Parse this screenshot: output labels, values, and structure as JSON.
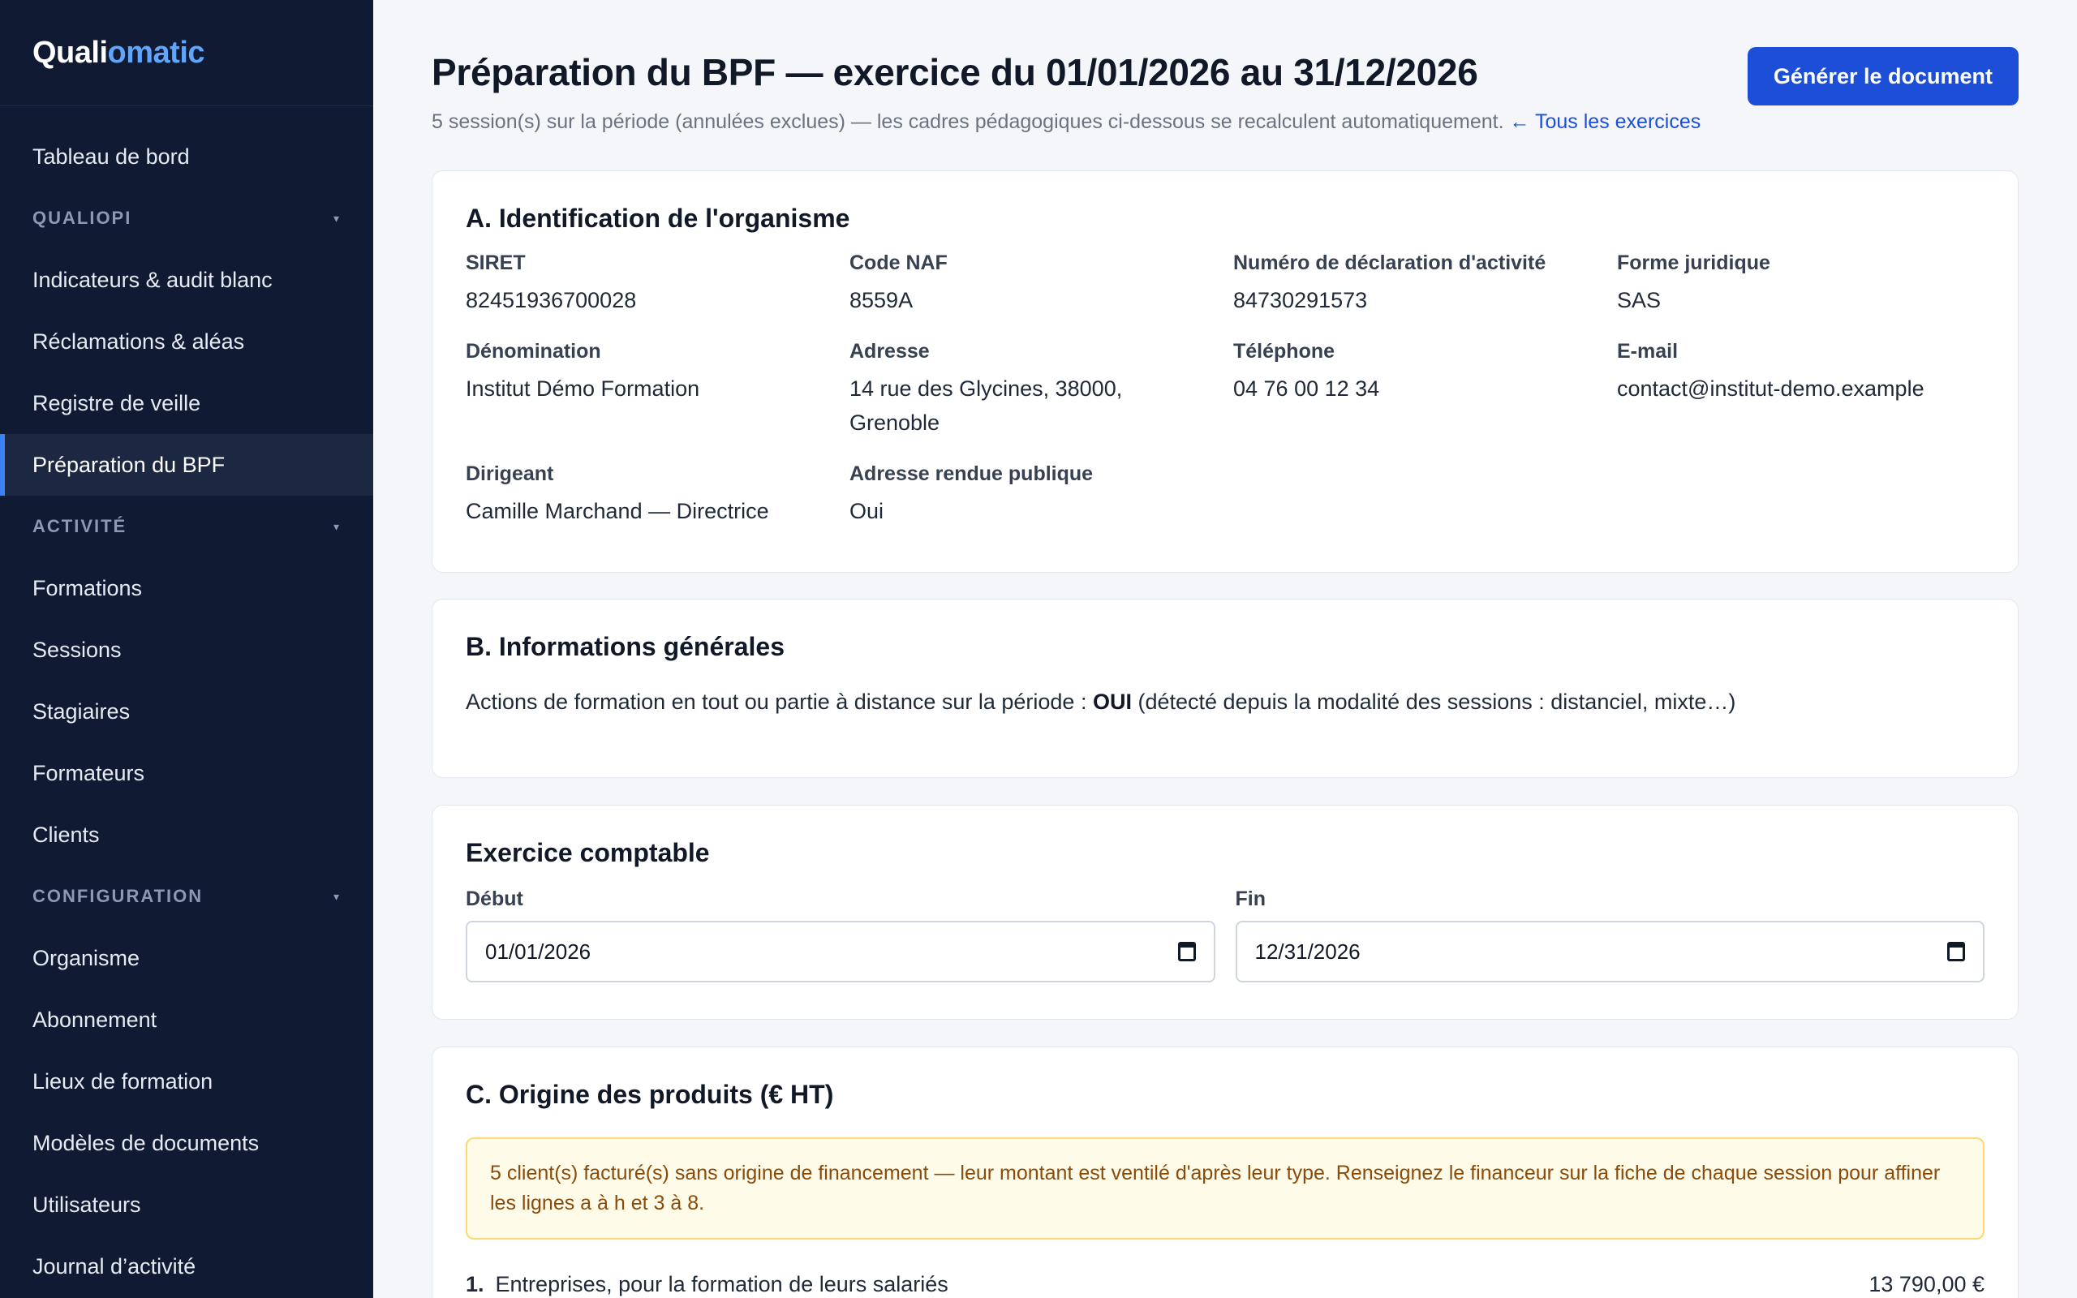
{
  "brand": {
    "part1": "Quali",
    "part2": "omatic"
  },
  "sidebar": {
    "dashboard": "Tableau de bord",
    "sections": [
      {
        "title": "QUALIOPI",
        "items": [
          "Indicateurs & audit blanc",
          "Réclamations & aléas",
          "Registre de veille",
          "Préparation du BPF"
        ]
      },
      {
        "title": "ACTIVITÉ",
        "items": [
          "Formations",
          "Sessions",
          "Stagiaires",
          "Formateurs",
          "Clients"
        ]
      },
      {
        "title": "CONFIGURATION",
        "items": [
          "Organisme",
          "Abonnement",
          "Lieux de formation",
          "Modèles de documents",
          "Utilisateurs",
          "Journal d’activité"
        ]
      }
    ],
    "active": "Préparation du BPF"
  },
  "header": {
    "title": "Préparation du BPF — exercice du 01/01/2026 au 31/12/2026",
    "subtitle": "5 session(s) sur la période (annulées exclues) — les cadres pédagogiques ci-dessous se recalculent automatiquement.",
    "back_link": "← Tous les exercices",
    "generate_button": "Générer le document"
  },
  "section_a": {
    "title": "A. Identification de l'organisme",
    "fields": [
      {
        "label": "SIRET",
        "value": "82451936700028"
      },
      {
        "label": "Code NAF",
        "value": "8559A"
      },
      {
        "label": "Numéro de déclaration d'activité",
        "value": "84730291573"
      },
      {
        "label": "Forme juridique",
        "value": "SAS"
      },
      {
        "label": "Dénomination",
        "value": "Institut Démo Formation"
      },
      {
        "label": "Adresse",
        "value": "14 rue des Glycines, 38000, Grenoble"
      },
      {
        "label": "Téléphone",
        "value": "04 76 00 12 34"
      },
      {
        "label": "E-mail",
        "value": "contact@institut-demo.example"
      },
      {
        "label": "Dirigeant",
        "value": "Camille Marchand — Directrice"
      },
      {
        "label": "Adresse rendue publique",
        "value": "Oui"
      }
    ]
  },
  "section_b": {
    "title": "B. Informations générales",
    "text_before": "Actions de formation en tout ou partie à distance sur la période :",
    "answer": "OUI",
    "text_after": "(détecté depuis la modalité des sessions : distanciel, mixte…)"
  },
  "exercice": {
    "title": "Exercice comptable",
    "start_label": "Début",
    "start_value": "01/01/2026",
    "end_label": "Fin",
    "end_value": "12/31/2026"
  },
  "section_c": {
    "title": "C. Origine des produits (€ HT)",
    "warning": "5 client(s) facturé(s) sans origine de financement — leur montant est ventilé d'après leur type. Renseignez le financeur sur la fiche de chaque session pour affiner les lignes a à h et 3 à 8.",
    "rows": [
      {
        "num": "1.",
        "label": "Entreprises, pour la formation de leurs salariés",
        "amount": "13 790,00 €"
      }
    ]
  }
}
